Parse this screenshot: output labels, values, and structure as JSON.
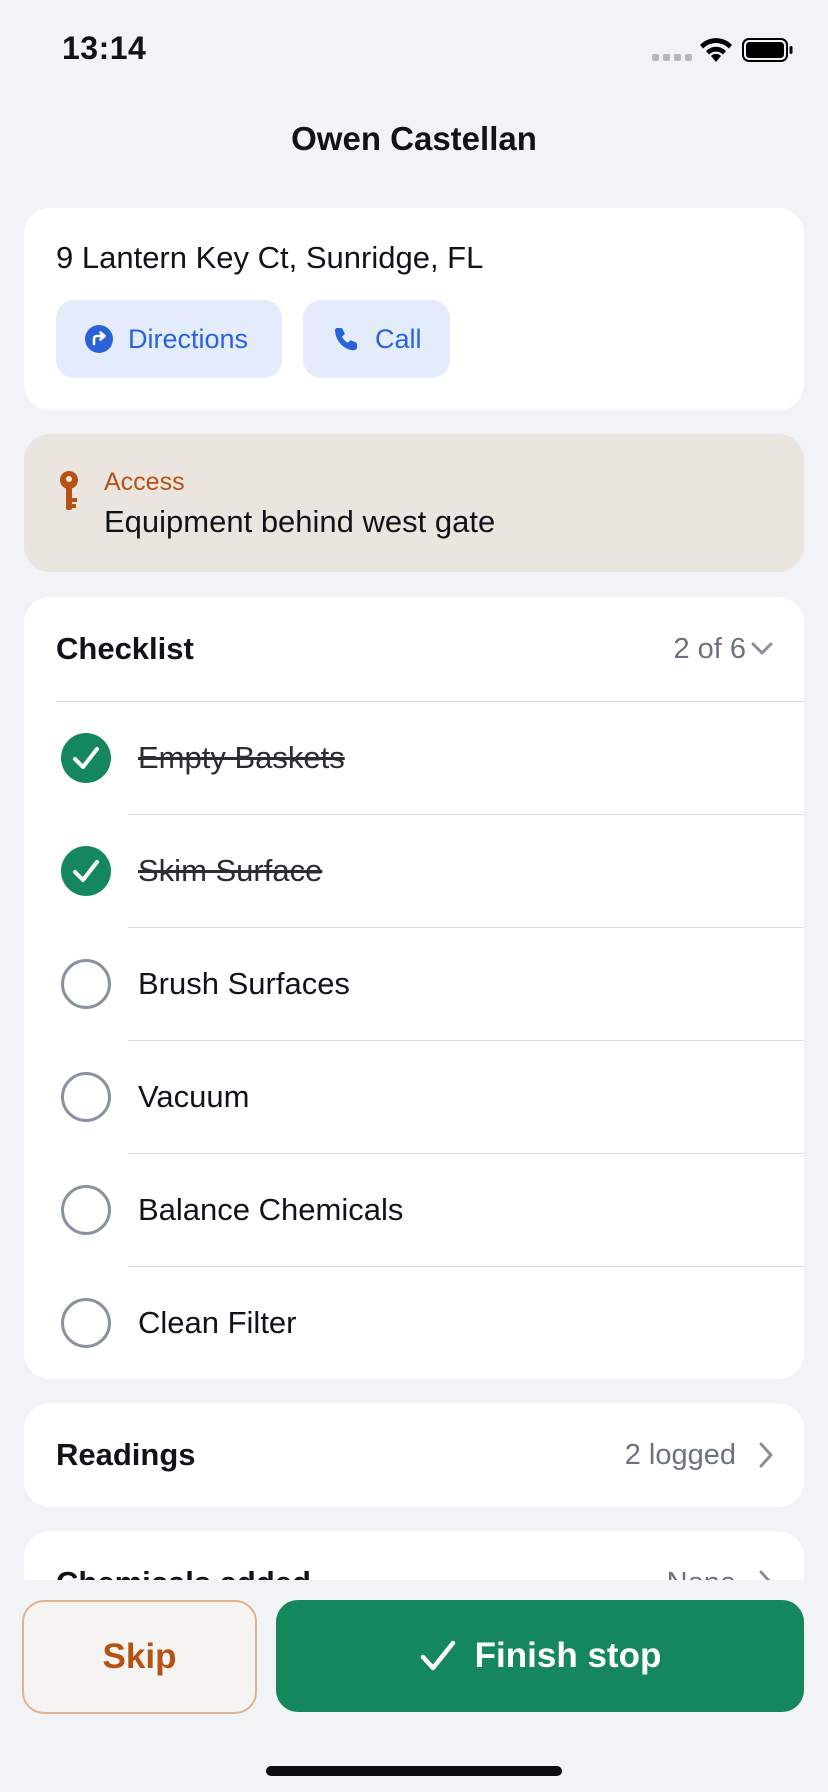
{
  "status_bar": {
    "time": "13:14"
  },
  "nav": {
    "title": "Owen Castellan"
  },
  "address": {
    "text": "9 Lantern Key Ct, Sunridge, FL",
    "directions_label": "Directions",
    "call_label": "Call"
  },
  "access": {
    "label": "Access",
    "value": "Equipment behind west gate"
  },
  "checklist": {
    "title": "Checklist",
    "count": "2 of 6",
    "items": [
      {
        "label": "Empty Baskets",
        "done": true
      },
      {
        "label": "Skim Surface",
        "done": true
      },
      {
        "label": "Brush Surfaces",
        "done": false
      },
      {
        "label": "Vacuum",
        "done": false
      },
      {
        "label": "Balance Chemicals",
        "done": false
      },
      {
        "label": "Clean Filter",
        "done": false
      }
    ]
  },
  "readings": {
    "title": "Readings",
    "value": "2 logged"
  },
  "chemicals": {
    "title": "Chemicals added",
    "value": "None"
  },
  "actions": {
    "skip_label": "Skip",
    "finish_label": "Finish stop"
  },
  "colors": {
    "accent_blue": "#2a63d9",
    "accent_green": "#14875c",
    "accent_orange": "#b45313",
    "background": "#f2f3f7"
  }
}
